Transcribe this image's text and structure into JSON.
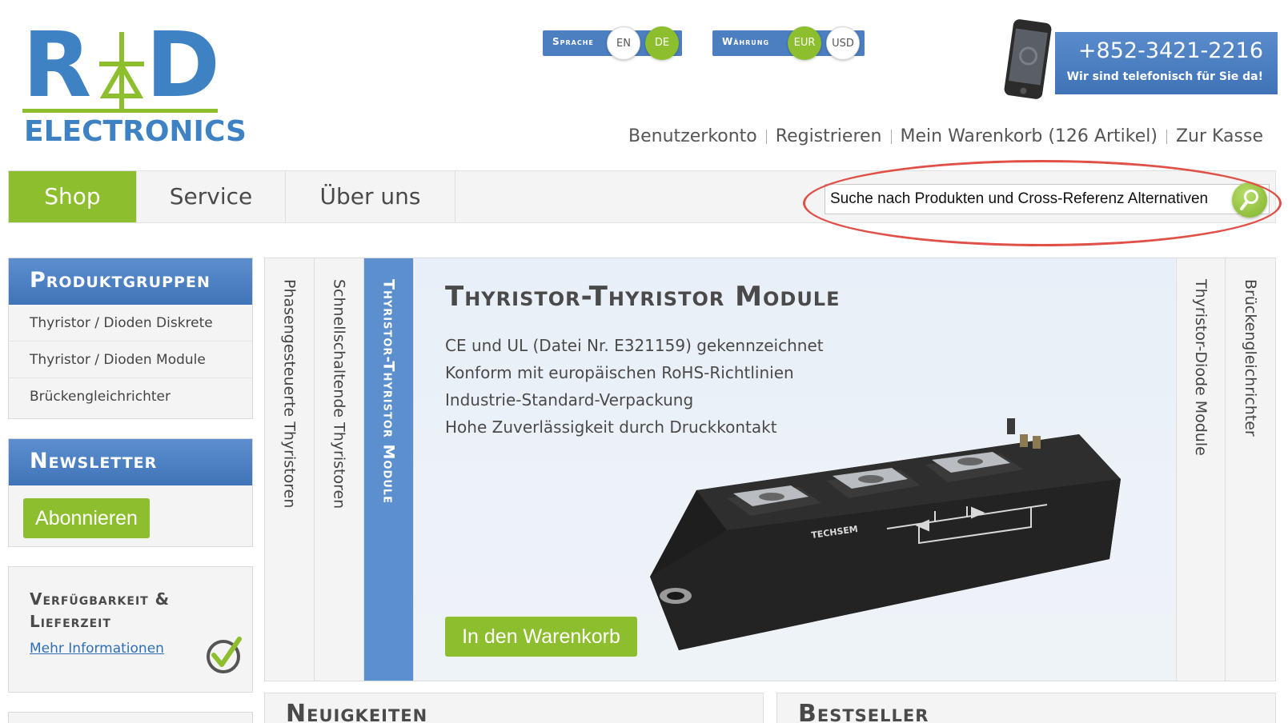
{
  "logo": {
    "letter_left": "R",
    "letter_right": "D",
    "subtitle": "ELECTRONICS",
    "brand_blue": "#3f82c3",
    "brand_green": "#8dbe2d"
  },
  "language": {
    "label": "Sprache",
    "options": [
      "EN",
      "DE"
    ],
    "selected": "DE"
  },
  "currency": {
    "label": "Währung",
    "options": [
      "EUR",
      "USD"
    ],
    "selected": "EUR"
  },
  "contact": {
    "phone": "+852-3421-2216",
    "subtitle": "Wir sind telefonisch für Sie da!"
  },
  "top_links": {
    "account": "Benutzerkonto",
    "register": "Registrieren",
    "cart": "Mein Warenkorb (126 Artikel)",
    "checkout": "Zur Kasse"
  },
  "nav": {
    "tabs": [
      "Shop",
      "Service",
      "Über uns"
    ],
    "active": "Shop"
  },
  "search": {
    "placeholder": "Suche nach Produkten und Cross-Referenz Alternativen",
    "highlight_color": "#e05047"
  },
  "sidebar": {
    "product_groups": {
      "title": "Produktgruppen",
      "items": [
        "Thyristor / Dioden Diskrete",
        "Thyristor / Dioden Module",
        "Brückengleichrichter"
      ]
    },
    "newsletter": {
      "title": "Newsletter",
      "button": "Abonnieren"
    },
    "availability": {
      "title_line1": "Verfügbarkeit &",
      "title_line2": "Lieferzeit",
      "link": "Mehr Informationen"
    }
  },
  "slider": {
    "tabs_left": [
      "Phasengesteuerte Thyristoren",
      "Schnellschaltende Thyristoren",
      "Thyristor-Thyristor Module"
    ],
    "tabs_right": [
      "Thyristor-Diode Module",
      "Brückengleichrichter"
    ],
    "active_tab": "Thyristor-Thyristor Module",
    "slide": {
      "title": "Thyristor-Thyristor Module",
      "features": [
        "CE und UL (Datei Nr. E321159) gekennzeichnet",
        "Konform mit europäischen RoHS-Richtlinien",
        "Industrie-Standard-Verpackung",
        "Hohe Zuverlässigkeit durch Druckkontakt"
      ],
      "cart_button": "In den Warenkorb",
      "product_brand": "TECHSEM"
    }
  },
  "sections": {
    "news": "Neuigkeiten",
    "bestseller": "Bestseller"
  }
}
